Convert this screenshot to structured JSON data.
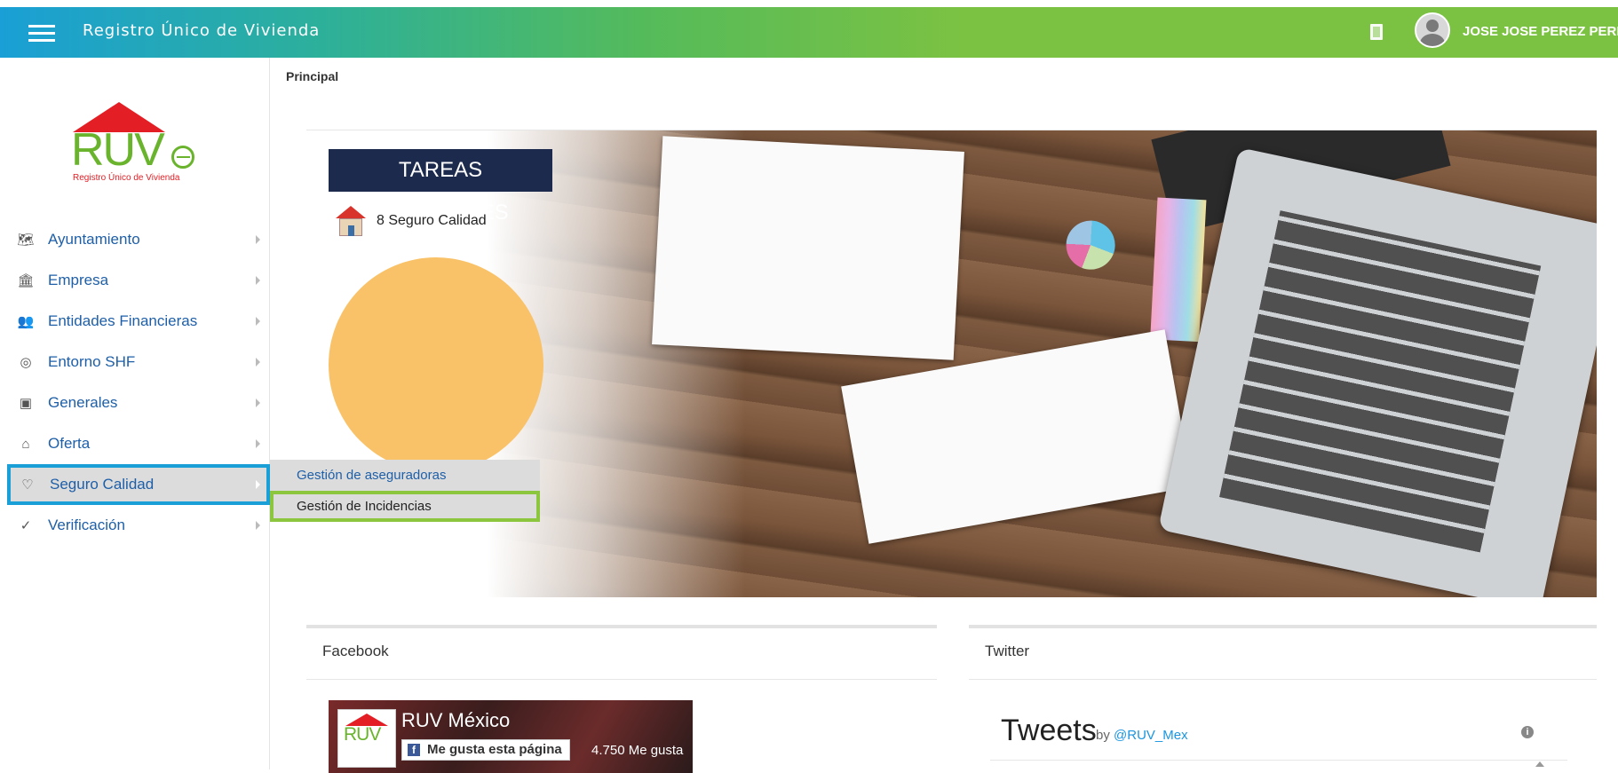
{
  "header": {
    "title": "Registro Único de Vivienda",
    "user_name": "JOSE JOSE PEREZ PEREZ"
  },
  "logo": {
    "text": "RUV",
    "subtitle": "Registro Único de Vivienda"
  },
  "sidebar": {
    "items": [
      {
        "label": "Ayuntamiento",
        "icon": "map-icon"
      },
      {
        "label": "Empresa",
        "icon": "building-icon"
      },
      {
        "label": "Entidades Financieras",
        "icon": "people-icon"
      },
      {
        "label": "Entorno SHF",
        "icon": "target-icon"
      },
      {
        "label": "Generales",
        "icon": "contact-card-icon"
      },
      {
        "label": "Oferta",
        "icon": "house-user-icon"
      },
      {
        "label": "Seguro Calidad",
        "icon": "handshake-icon",
        "active": true
      },
      {
        "label": "Verificación",
        "icon": "check-circle-icon"
      }
    ],
    "submenu": [
      {
        "label": "Gestión de aseguradoras"
      },
      {
        "label": "Gestión de Incidencias",
        "highlighted": true
      }
    ]
  },
  "breadcrumb": "Principal",
  "tareas": {
    "title": "TAREAS PENDIENTES",
    "item": "8 Seguro Calidad"
  },
  "panels": {
    "facebook": {
      "heading": "Facebook",
      "page_name": "RUV México",
      "like_button": "Me gusta esta página",
      "like_count": "4.750 Me gusta"
    },
    "twitter": {
      "heading": "Twitter",
      "tweets_title": "Tweets",
      "by_prefix": "by",
      "handle": "@RUV_Mex"
    }
  },
  "colors": {
    "header_start": "#1a9fd6",
    "header_end": "#7cc242",
    "active_outline": "#1a9fd6",
    "submenu_highlight": "#8cc63f",
    "circle": "#f9c268",
    "link": "#1e5fa8"
  }
}
